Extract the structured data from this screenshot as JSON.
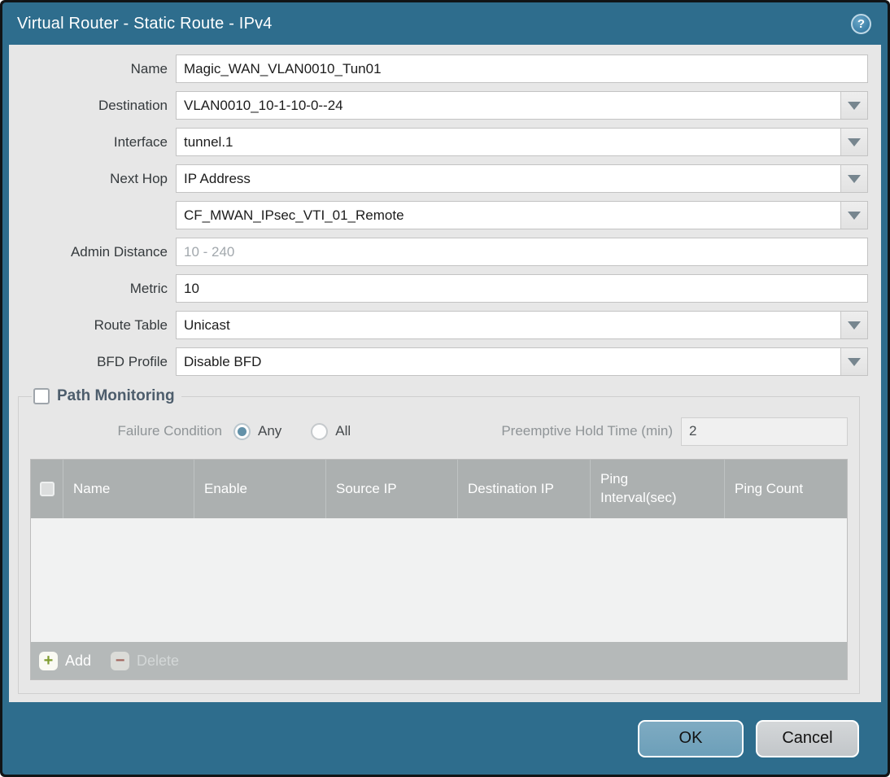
{
  "titlebar": {
    "title": "Virtual Router - Static Route - IPv4",
    "help_glyph": "?"
  },
  "form": {
    "name": {
      "label": "Name",
      "value": "Magic_WAN_VLAN0010_Tun01"
    },
    "destination": {
      "label": "Destination",
      "value": "VLAN0010_10-1-10-0--24"
    },
    "interface": {
      "label": "Interface",
      "value": "tunnel.1"
    },
    "next_hop": {
      "label": "Next Hop",
      "value": "IP Address"
    },
    "next_hop_address": {
      "value": "CF_MWAN_IPsec_VTI_01_Remote"
    },
    "admin_distance": {
      "label": "Admin Distance",
      "value": "",
      "placeholder": "10 - 240"
    },
    "metric": {
      "label": "Metric",
      "value": "10"
    },
    "route_table": {
      "label": "Route Table",
      "value": "Unicast"
    },
    "bfd_profile": {
      "label": "BFD Profile",
      "value": "Disable BFD"
    }
  },
  "path_monitoring": {
    "legend": "Path Monitoring",
    "checkbox_checked": false,
    "failure_condition": {
      "label": "Failure Condition",
      "options": [
        "Any",
        "All"
      ],
      "selected": "Any"
    },
    "preemptive_hold_time": {
      "label": "Preemptive Hold Time (min)",
      "value": "2"
    },
    "table": {
      "headers": [
        "Name",
        "Enable",
        "Source IP",
        "Destination IP",
        "Ping Interval(sec)",
        "Ping Count"
      ],
      "rows": []
    },
    "toolbar": {
      "add_label": "Add",
      "add_glyph": "+",
      "delete_label": "Delete",
      "delete_glyph": "−",
      "delete_enabled": false
    }
  },
  "footer": {
    "ok_label": "OK",
    "cancel_label": "Cancel"
  },
  "colors": {
    "frame_teal": "#2e6d8d",
    "body_gray": "#e7e7e7",
    "table_header_gray": "#acb0b0",
    "toolbar_gray": "#b5b9b9",
    "ok_button_blue": "#74a3bc",
    "cancel_button_gray": "#c9cdcf",
    "radio_selected_dot": "#6291a9",
    "legend_text": "#4d5d6c"
  }
}
